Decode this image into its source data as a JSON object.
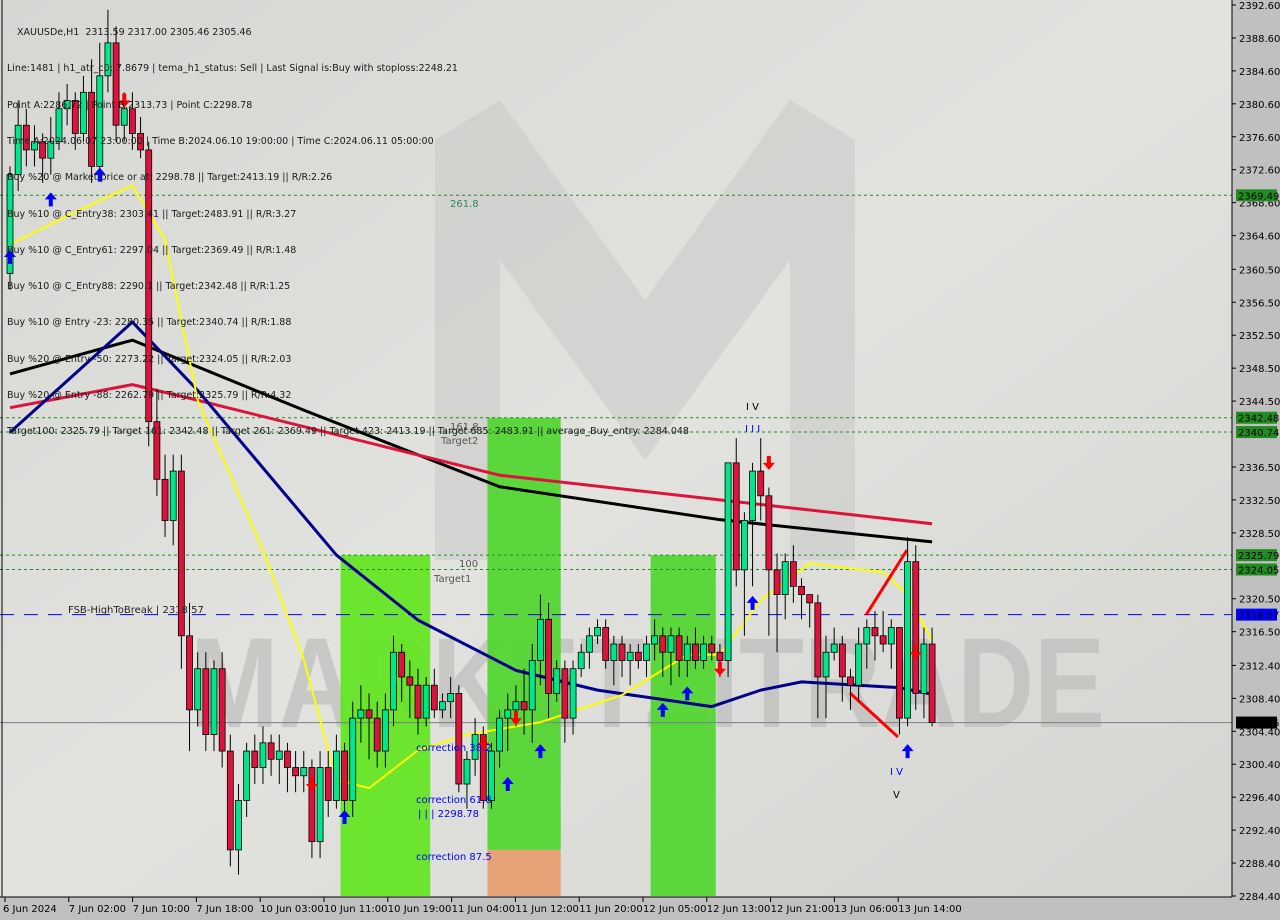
{
  "header": {
    "title": "XAUUSDe,H1  2313.59 2317.00 2305.46 2305.46",
    "lines": [
      "Line:1481 | h1_atr_c0: 7.8679 | tema_h1_status: Sell | Last Signal is:Buy with stoploss:2248.21",
      "Point A:2286.72 | Point B:2313.73 | Point C:2298.78",
      "Time A:2024.06.07 23:00:00 | Time B:2024.06.10 19:00:00 | Time C:2024.06.11 05:00:00",
      "Buy %20 @ Market price or at: 2298.78 || Target:2413.19 || R/R:2.26",
      "Buy %10 @ C_Entry38: 2303.41 || Target:2483.91 || R/R:3.27",
      "Buy %10 @ C_Entry61: 2297.04 || Target:2369.49 || R/R:1.48",
      "Buy %10 @ C_Entry88: 2290.1 || Target:2342.48 || R/R:1.25",
      "Buy %10 @ Entry -23: 2280.35 || Target:2340.74 || R/R:1.88",
      "Buy %20 @ Entry -50: 2273.22 || Target:2324.05 || R/R:2.03",
      "Buy %20 @ Entry -88: 2262.79 || Target:2325.79 || R/R:4.32",
      "Target100: 2325.79 || Target 161: 2342.48 || Target 261: 2369.49 || Target 423: 2413.19 || Target 685: 2483.91 || average_Buy_entry: 2284.048"
    ]
  },
  "watermark": "MARKETZITRADE",
  "colors": {
    "background": "#d8d8d5",
    "bull": "#00e68a",
    "bear": "#dc143c",
    "ma_black": "#000000",
    "ma_red": "#dc143c",
    "ma_blue": "#00008b",
    "ma_yellow": "#ffff00",
    "zone_green": "#4cd62a",
    "zone_orange": "#e89a6a",
    "level_green": "#228b22",
    "fsb_blue": "#0000ff",
    "signal_up": "#0000ff",
    "signal_down": "#ff0000"
  },
  "chart_data": {
    "type": "candlestick",
    "symbol": "XAUUSDe",
    "timeframe": "H1",
    "ylim": [
      2284.4,
      2392.6
    ],
    "y_ticks": [
      "2392.60",
      "2388.60",
      "2384.60",
      "2380.60",
      "2376.60",
      "2372.60",
      "2368.60",
      "2364.60",
      "2360.50",
      "2356.50",
      "2352.50",
      "2348.50",
      "2344.50",
      "2336.50",
      "2332.50",
      "2328.50",
      "2320.50",
      "2316.50",
      "2312.40",
      "2308.40",
      "2304.40",
      "2300.40",
      "2296.40",
      "2292.40",
      "2288.40",
      "2284.40"
    ],
    "x_ticks": [
      "6 Jun 2024",
      "7 Jun 02:00",
      "7 Jun 10:00",
      "7 Jun 18:00",
      "10 Jun 03:00",
      "10 Jun 11:00",
      "10 Jun 19:00",
      "11 Jun 04:00",
      "11 Jun 12:00",
      "11 Jun 20:00",
      "12 Jun 05:00",
      "12 Jun 13:00",
      "12 Jun 21:00",
      "13 Jun 06:00",
      "13 Jun 14:00"
    ],
    "ohlc": [
      [
        2360,
        2373,
        2358,
        2372
      ],
      [
        2372,
        2381,
        2370,
        2378
      ],
      [
        2378,
        2380,
        2373,
        2375
      ],
      [
        2375,
        2378,
        2373,
        2376
      ],
      [
        2376,
        2377,
        2371,
        2374
      ],
      [
        2374,
        2379,
        2372,
        2376
      ],
      [
        2376,
        2382,
        2375,
        2380
      ],
      [
        2380,
        2383,
        2378,
        2381
      ],
      [
        2381,
        2382,
        2375,
        2377
      ],
      [
        2377,
        2384,
        2376,
        2382
      ],
      [
        2382,
        2386,
        2371,
        2373
      ],
      [
        2373,
        2388,
        2372,
        2384
      ],
      [
        2384,
        2392,
        2382,
        2388
      ],
      [
        2388,
        2390,
        2376,
        2378
      ],
      [
        2378,
        2382,
        2376,
        2380
      ],
      [
        2380,
        2382,
        2375,
        2377
      ],
      [
        2377,
        2379,
        2374,
        2375
      ],
      [
        2375,
        2376,
        2339,
        2342
      ],
      [
        2342,
        2346,
        2333,
        2335
      ],
      [
        2335,
        2338,
        2328,
        2330
      ],
      [
        2330,
        2338,
        2327,
        2336
      ],
      [
        2336,
        2338,
        2312,
        2316
      ],
      [
        2316,
        2320,
        2302,
        2307
      ],
      [
        2307,
        2314,
        2305,
        2312
      ],
      [
        2312,
        2314,
        2302,
        2304
      ],
      [
        2304,
        2313,
        2302,
        2312
      ],
      [
        2312,
        2314,
        2300,
        2302
      ],
      [
        2302,
        2304,
        2288,
        2290
      ],
      [
        2290,
        2298,
        2287,
        2296
      ],
      [
        2296,
        2303,
        2294,
        2302
      ],
      [
        2302,
        2304,
        2298,
        2300
      ],
      [
        2300,
        2305,
        2298,
        2303
      ],
      [
        2303,
        2304,
        2299,
        2301
      ],
      [
        2301,
        2304,
        2298,
        2302
      ],
      [
        2302,
        2303,
        2297,
        2300
      ],
      [
        2300,
        2302,
        2297,
        2299
      ],
      [
        2299,
        2302,
        2297,
        2300
      ],
      [
        2300,
        2301,
        2289,
        2291
      ],
      [
        2291,
        2302,
        2289,
        2300
      ],
      [
        2300,
        2302,
        2294,
        2296
      ],
      [
        2296,
        2304,
        2295,
        2302
      ],
      [
        2302,
        2303,
        2294,
        2296
      ],
      [
        2296,
        2308,
        2294,
        2306
      ],
      [
        2306,
        2310,
        2303,
        2307
      ],
      [
        2307,
        2309,
        2301,
        2306
      ],
      [
        2306,
        2308,
        2300,
        2302
      ],
      [
        2302,
        2309,
        2300,
        2307
      ],
      [
        2307,
        2316,
        2305,
        2314
      ],
      [
        2314,
        2315,
        2308,
        2311
      ],
      [
        2311,
        2313,
        2306,
        2310
      ],
      [
        2310,
        2312,
        2304,
        2306
      ],
      [
        2306,
        2311,
        2305,
        2310
      ],
      [
        2310,
        2312,
        2306,
        2307
      ],
      [
        2307,
        2309,
        2306,
        2308
      ],
      [
        2308,
        2311,
        2306,
        2309
      ],
      [
        2309,
        2310,
        2297,
        2298
      ],
      [
        2298,
        2302,
        2295,
        2301
      ],
      [
        2301,
        2306,
        2299,
        2304
      ],
      [
        2304,
        2305,
        2295,
        2296
      ],
      [
        2296,
        2303,
        2295,
        2302
      ],
      [
        2302,
        2307,
        2300,
        2306
      ],
      [
        2306,
        2309,
        2302,
        2307
      ],
      [
        2307,
        2310,
        2305,
        2308
      ],
      [
        2308,
        2312,
        2304,
        2307
      ],
      [
        2307,
        2315,
        2303,
        2313
      ],
      [
        2313,
        2321,
        2310,
        2318
      ],
      [
        2318,
        2320,
        2306,
        2309
      ],
      [
        2309,
        2313,
        2308,
        2312
      ],
      [
        2312,
        2313,
        2303,
        2306
      ],
      [
        2306,
        2313,
        2304,
        2312
      ],
      [
        2312,
        2315,
        2311,
        2314
      ],
      [
        2314,
        2317,
        2312,
        2316
      ],
      [
        2316,
        2318,
        2315,
        2317
      ],
      [
        2317,
        2318,
        2312,
        2313
      ],
      [
        2313,
        2316,
        2310,
        2315
      ],
      [
        2315,
        2316,
        2311,
        2313
      ],
      [
        2313,
        2315,
        2310,
        2314
      ],
      [
        2314,
        2315,
        2312,
        2313
      ],
      [
        2313,
        2316,
        2311,
        2315
      ],
      [
        2315,
        2318,
        2313,
        2316
      ],
      [
        2316,
        2317,
        2311,
        2314
      ],
      [
        2314,
        2317,
        2310,
        2316
      ],
      [
        2316,
        2317,
        2311,
        2313
      ],
      [
        2313,
        2316,
        2311,
        2315
      ],
      [
        2315,
        2317,
        2312,
        2313
      ],
      [
        2313,
        2316,
        2312,
        2315
      ],
      [
        2315,
        2316,
        2313,
        2314
      ],
      [
        2314,
        2315,
        2311,
        2313
      ],
      [
        2313,
        2337,
        2311,
        2337
      ],
      [
        2337,
        2340,
        2322,
        2324
      ],
      [
        2324,
        2331,
        2316,
        2330
      ],
      [
        2330,
        2337,
        2322,
        2336
      ],
      [
        2336,
        2340,
        2330,
        2333
      ],
      [
        2333,
        2334,
        2316,
        2324
      ],
      [
        2324,
        2326,
        2314,
        2321
      ],
      [
        2321,
        2326,
        2318,
        2325
      ],
      [
        2325,
        2327,
        2320,
        2322
      ],
      [
        2322,
        2323,
        2318,
        2321
      ],
      [
        2321,
        2321,
        2317,
        2320
      ],
      [
        2320,
        2321,
        2306,
        2311
      ],
      [
        2311,
        2316,
        2306,
        2314
      ],
      [
        2314,
        2317,
        2313,
        2315
      ],
      [
        2315,
        2316,
        2308,
        2311
      ],
      [
        2311,
        2312,
        2307,
        2310
      ],
      [
        2310,
        2317,
        2308,
        2315
      ],
      [
        2315,
        2318,
        2312,
        2317
      ],
      [
        2317,
        2319,
        2313,
        2316
      ],
      [
        2316,
        2319,
        2314,
        2315
      ],
      [
        2315,
        2318,
        2312,
        2317
      ],
      [
        2317,
        2317,
        2304,
        2306
      ],
      [
        2306,
        2328,
        2305,
        2325
      ],
      [
        2325,
        2327,
        2307,
        2309
      ],
      [
        2309,
        2317,
        2306,
        2315
      ],
      [
        2315,
        2317,
        2305,
        2305.46
      ]
    ],
    "moving_averages": [
      {
        "color": "#000000",
        "points": [
          [
            0,
            2347.8
          ],
          [
            15,
            2351.9
          ],
          [
            36,
            2343.4
          ],
          [
            60,
            2334.1
          ],
          [
            87,
            2330.1
          ],
          [
            113,
            2327.4
          ]
        ]
      },
      {
        "color": "#dc143c",
        "points": [
          [
            0,
            2343.7
          ],
          [
            15,
            2346.5
          ],
          [
            23,
            2344.6
          ],
          [
            60,
            2335.5
          ],
          [
            87,
            2332.5
          ],
          [
            113,
            2329.6
          ]
        ]
      },
      {
        "color": "#00008b",
        "points": [
          [
            0,
            2340.7
          ],
          [
            15,
            2354.1
          ],
          [
            23,
            2345.8
          ],
          [
            40,
            2325.8
          ],
          [
            50,
            2317.9
          ],
          [
            62,
            2311.8
          ],
          [
            72,
            2309.4
          ],
          [
            86,
            2307.4
          ],
          [
            92,
            2309.4
          ],
          [
            97,
            2310.4
          ],
          [
            109,
            2309.7
          ],
          [
            113,
            2308.9
          ]
        ]
      },
      {
        "color": "#ffff00",
        "points": [
          [
            0,
            2363.5
          ],
          [
            6,
            2366.5
          ],
          [
            15,
            2370.7
          ],
          [
            19,
            2364.1
          ],
          [
            23,
            2344.6
          ],
          [
            31,
            2326.4
          ],
          [
            36,
            2313.1
          ],
          [
            40,
            2298.5
          ],
          [
            44,
            2297.5
          ],
          [
            50,
            2302.1
          ],
          [
            56,
            2304.0
          ],
          [
            65,
            2305.5
          ],
          [
            75,
            2308.8
          ],
          [
            83,
            2313.7
          ],
          [
            87,
            2313.7
          ],
          [
            92,
            2320.3
          ],
          [
            98,
            2324.8
          ],
          [
            107,
            2323.7
          ],
          [
            110,
            2321.0
          ],
          [
            113,
            2315.5
          ]
        ]
      }
    ],
    "levels": [
      {
        "price": 2369.49,
        "label": "2369.49",
        "style": "green-dotted"
      },
      {
        "price": 2342.48,
        "label": "2342.48",
        "style": "green-dotted"
      },
      {
        "price": 2340.74,
        "label": "2340.74",
        "style": "green-dotted"
      },
      {
        "price": 2325.79,
        "label": "2325.79",
        "style": "green-dotted"
      },
      {
        "price": 2324.05,
        "label": "2324.05",
        "style": "green-dotted"
      },
      {
        "price": 2318.57,
        "label": "2318.57",
        "style": "blue-dashed"
      },
      {
        "price": 2305.46,
        "label": "2305.46",
        "style": "current-price"
      }
    ],
    "zones": [
      {
        "from_bar": 41,
        "to_bar": 51,
        "top": 2325.79,
        "bottom": 2284.4,
        "color": "#5ee61a"
      },
      {
        "from_bar": 59,
        "to_bar": 67,
        "top": 2342.48,
        "bottom": 2290.0,
        "color": "#4cd62a"
      },
      {
        "from_bar": 59,
        "to_bar": 67,
        "top": 2290.0,
        "bottom": 2284.4,
        "color": "#e89a6a"
      },
      {
        "from_bar": 79,
        "to_bar": 86,
        "top": 2325.79,
        "bottom": 2284.4,
        "color": "#4cd62a"
      }
    ],
    "annotations": {
      "fib_261": "261.8",
      "fib_161": "161.8",
      "target2": "Target2",
      "fib_100": "100",
      "target1": "Target1",
      "correction_38": "correction 38.2",
      "correction_61": "correction 61.8",
      "point_c": "| | | 2298.78",
      "correction_87": "correction 87.5",
      "fsb": "FSB-HighToBreak | 2318.57",
      "wave_iv_top": "I V",
      "wave_iii_top": "I I I",
      "wave_iv_bottom": "I V",
      "wave_v_bottom": "V"
    },
    "signals_up": [
      [
        0,
        2362
      ],
      [
        5,
        2369
      ],
      [
        11,
        2372
      ],
      [
        41,
        2294
      ],
      [
        61,
        2298
      ],
      [
        65,
        2302
      ],
      [
        80,
        2307
      ],
      [
        83,
        2309
      ],
      [
        91,
        2320
      ],
      [
        110,
        2302
      ]
    ],
    "signals_down": [
      [
        14,
        2381
      ],
      [
        37,
        2298
      ],
      [
        58,
        2303
      ],
      [
        62,
        2306
      ],
      [
        87,
        2312
      ],
      [
        93,
        2337
      ],
      [
        111,
        2314
      ]
    ]
  }
}
